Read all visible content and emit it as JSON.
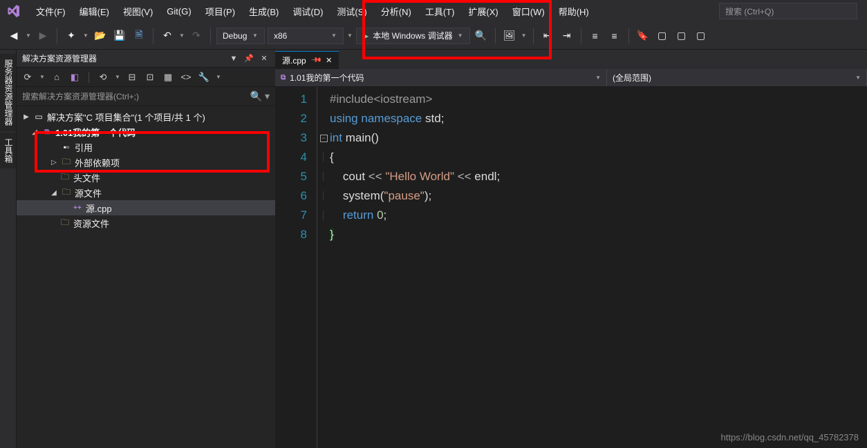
{
  "menu": {
    "file": "文件(F)",
    "edit": "编辑(E)",
    "view": "视图(V)",
    "git": "Git(G)",
    "project": "项目(P)",
    "build": "生成(B)",
    "debug": "调试(D)",
    "test": "测试(S)",
    "analyze": "分析(N)",
    "tools": "工具(T)",
    "extensions": "扩展(X)",
    "window": "窗口(W)",
    "help": "帮助(H)"
  },
  "search": {
    "placeholder": "搜索 (Ctrl+Q)"
  },
  "toolbar": {
    "config": "Debug",
    "platform": "x86",
    "debugger": "本地 Windows 调试器"
  },
  "left_tabs": {
    "server": "服务器资源管理器",
    "toolbox": "工具箱"
  },
  "solution": {
    "title": "解决方案资源管理器",
    "search_placeholder": "搜索解决方案资源管理器(Ctrl+;)",
    "root": "解决方案\"C    项目集合\"(1 个项目/共 1 个)",
    "project": "1.01我的第一个代码",
    "refs": "引用",
    "external": "外部依赖项",
    "headers": "头文件",
    "sources": "源文件",
    "source_file": "源.cpp",
    "resources": "资源文件"
  },
  "editor": {
    "tab": "源.cpp",
    "nav_left": "1.01我的第一个代码",
    "nav_right": "(全局范围)"
  },
  "code": {
    "l1_a": "#include",
    "l1_b": "<iostream>",
    "l2_a": "using",
    "l2_b": "namespace",
    "l2_c": "std",
    "l2_d": ";",
    "l3_a": "int",
    "l3_b": "main",
    "l3_c": "()",
    "l4": "{",
    "l5_a": "cout",
    "l5_b": " << ",
    "l5_c": "\"Hello World\"",
    "l5_d": " << ",
    "l5_e": "endl",
    "l5_f": ";",
    "l6_a": "system",
    "l6_b": "(",
    "l6_c": "\"pause\"",
    "l6_d": ")",
    "l6_e": ";",
    "l7_a": "return",
    "l7_b": "0",
    "l7_c": ";",
    "l8": "}"
  },
  "lines": {
    "n1": "1",
    "n2": "2",
    "n3": "3",
    "n4": "4",
    "n5": "5",
    "n6": "6",
    "n7": "7",
    "n8": "8"
  },
  "watermark": "https://blog.csdn.net/qq_45782378"
}
